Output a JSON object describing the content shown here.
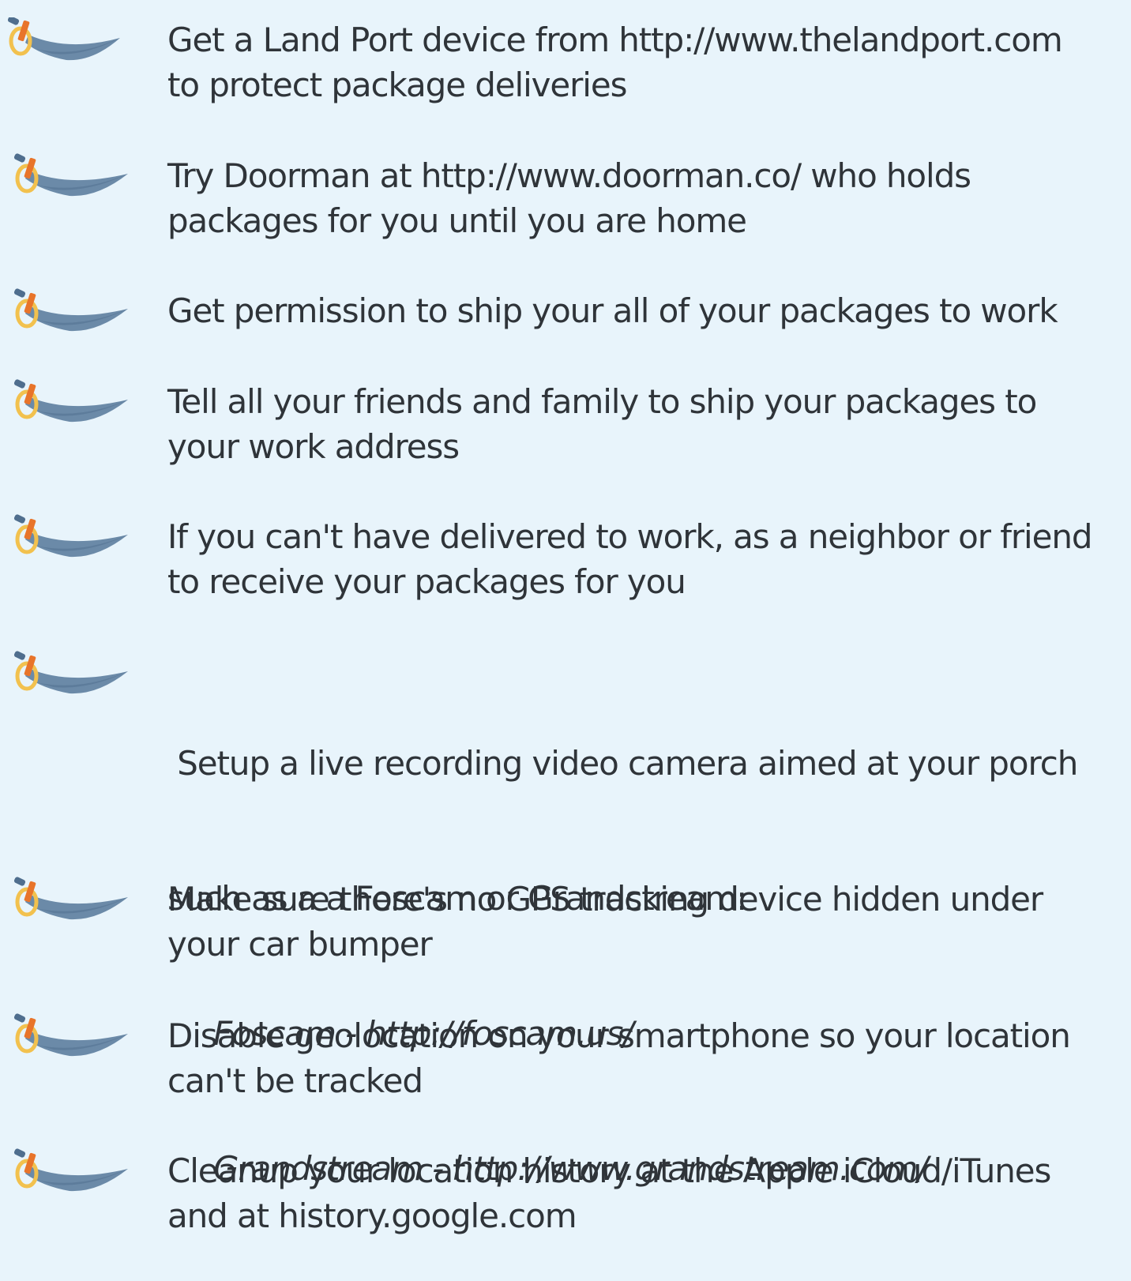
{
  "bullet_icon": "scimitar-sword-icon",
  "colors": {
    "background": "#e8f4fb",
    "text": "#2f3439",
    "blade": "#6b8aa8",
    "blade_dark": "#4f6e8e",
    "guard": "#f2c14e",
    "wrap": "#e8742a"
  },
  "tips": [
    {
      "lines": [
        "Get a Land Port device from http://www.thelandport.com",
        "to protect package deliveries"
      ]
    },
    {
      "lines": [
        "Try Doorman  at http://www.doorman.co/  who holds",
        "packages for you until you are home"
      ]
    },
    {
      "lines": [
        "Get permission to ship your all of your packages to work"
      ]
    },
    {
      "lines": [
        "Tell all your friends and family to ship your packages to",
        "your work address"
      ]
    },
    {
      "lines": [
        "If you can't have delivered to work, as a neighbor or friend",
        "to receive your packages for you"
      ]
    },
    {
      "lines": [
        " Setup a live recording video camera aimed at your porch",
        "such as a a Foscam or Grandstream:"
      ],
      "sublines": [
        "Foscam - http://foscam.us/",
        "Grandstream - http://www.grandstream.com/"
      ]
    },
    {
      "lines": [
        "Make sure there's no GPS tracking device hidden under",
        "your car bumper"
      ]
    },
    {
      "lines": [
        "Disable geolocation on your smartphone so your location",
        "can't be tracked"
      ]
    },
    {
      "lines": [
        "Cleanup your location history at the Apple iCloud/iTunes",
        "and at history.google.com"
      ]
    }
  ]
}
